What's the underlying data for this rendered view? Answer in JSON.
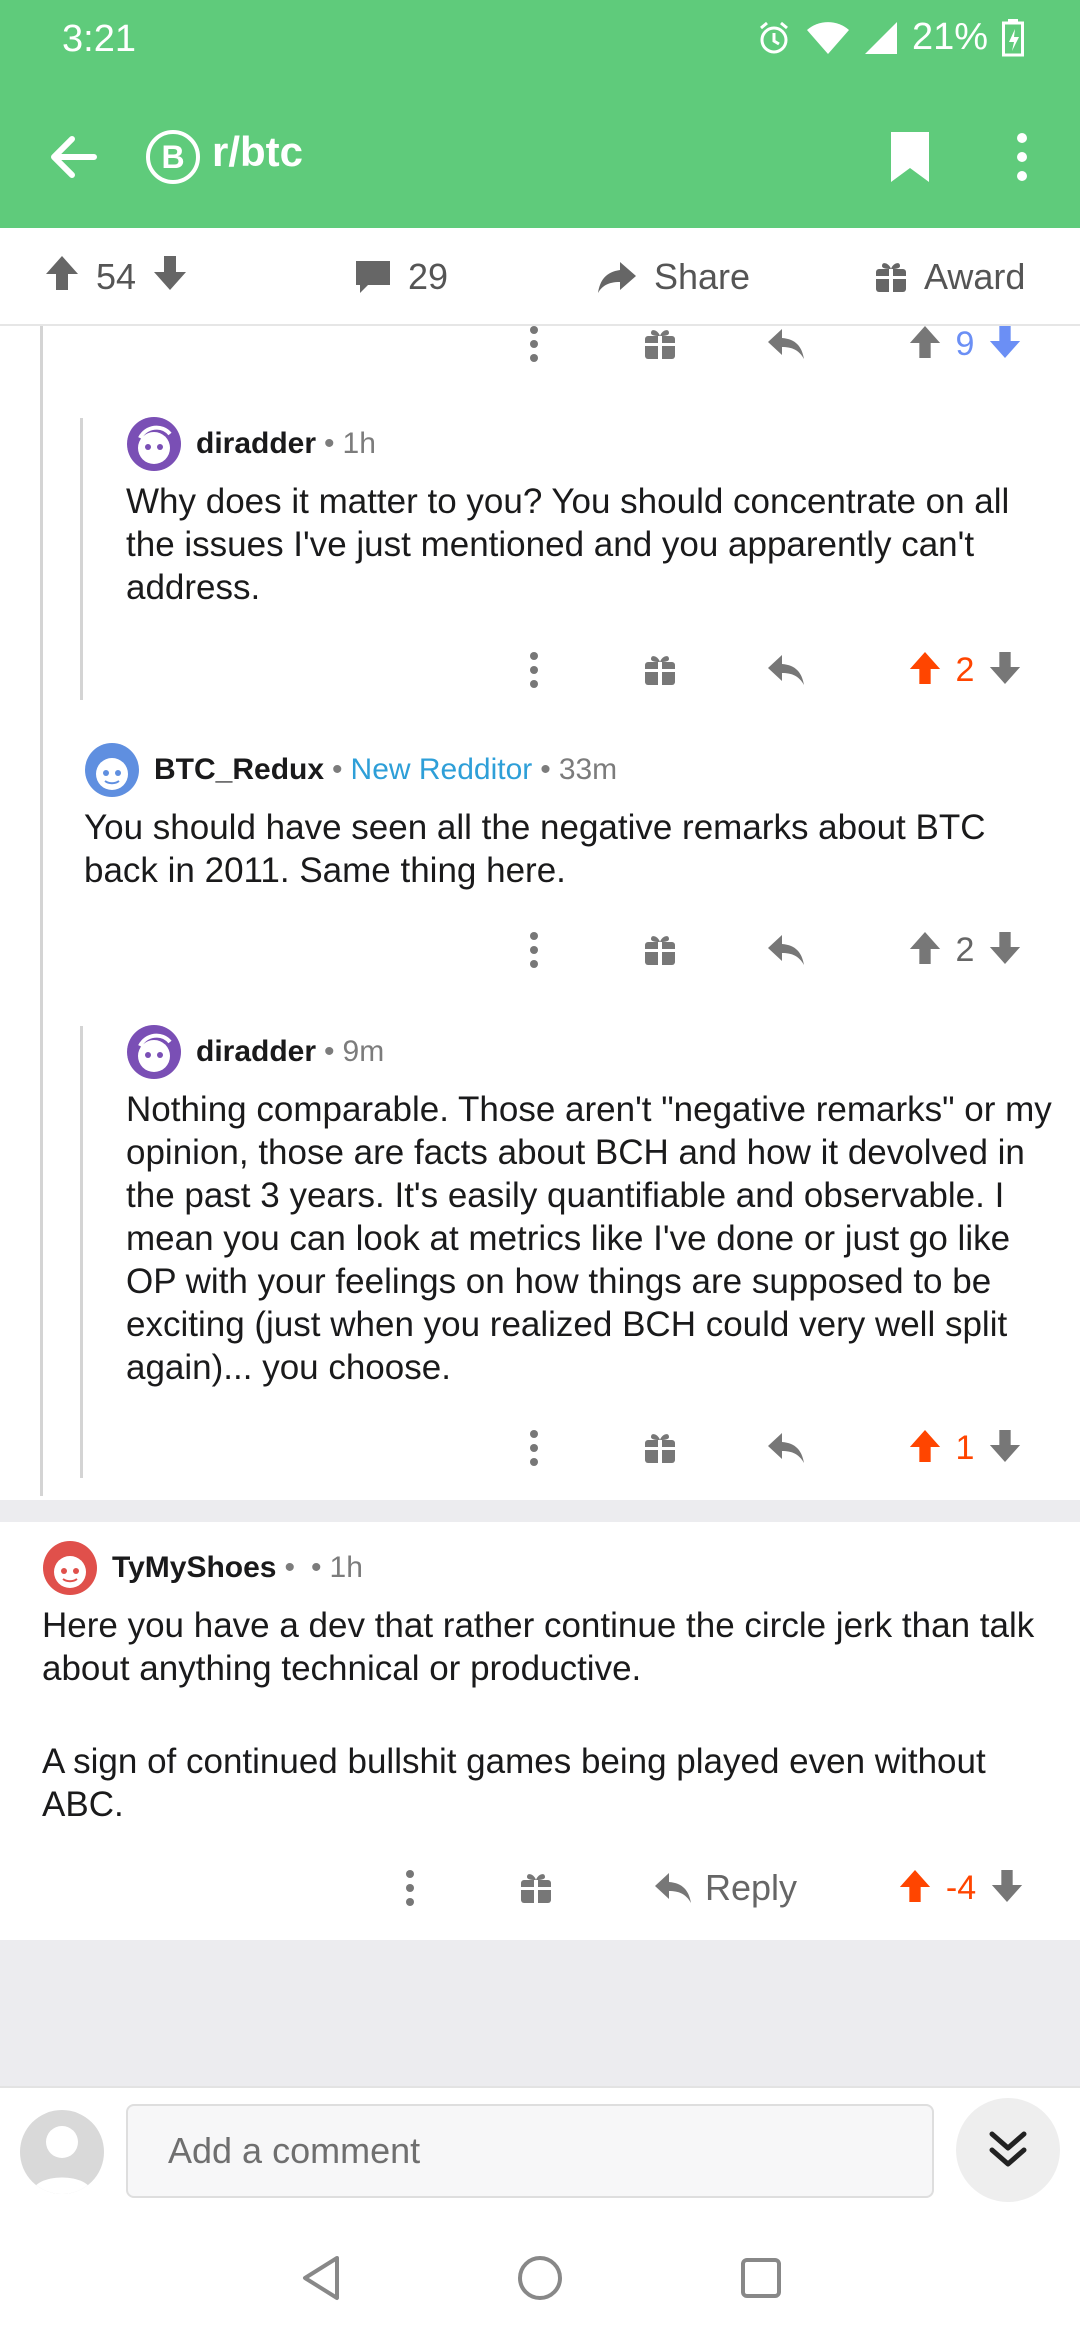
{
  "status_bar": {
    "time": "3:21",
    "battery": "21%"
  },
  "app_bar": {
    "subreddit": "r/btc",
    "subreddit_icon_letter": "B"
  },
  "post_bar": {
    "score": "54",
    "comments": "29",
    "share_label": "Share",
    "award_label": "Award"
  },
  "colors": {
    "header_green": "#5fcb7b",
    "upvote_orange": "#ff4500",
    "flair_blue": "#2e9fd8",
    "downvote_blue": "#6b8ff5"
  },
  "comments": [
    {
      "score": "9"
    },
    {
      "author": "diradder",
      "time": "1h",
      "body": "Why does it matter to you? You should concentrate on all the issues I've just mentioned and you apparently can't address.",
      "score": "2"
    },
    {
      "author": "BTC_Redux",
      "flair": "New Redditor",
      "time": "33m",
      "body": "You should have seen all the negative remarks about BTC back in 2011.  Same thing here.",
      "score": "2"
    },
    {
      "author": "diradder",
      "time": "9m",
      "body": "Nothing comparable. Those aren't \"negative remarks\" or my opinion, those are facts about BCH and how it devolved in the past 3 years. It's easily quantifiable and observable. I mean you can look at metrics like I've done or just go like OP with your feelings on how things are supposed to be exciting (just when you realized BCH could very well split again)... you choose.",
      "score": "1"
    },
    {
      "author": "TyMyShoes",
      "time": "1h",
      "body_p1": "Here you have a dev that rather continue the circle jerk than talk about anything technical or productive.",
      "body_p2": "A sign of continued bullshit games being played even without ABC.",
      "reply_label": "Reply",
      "score": "-4"
    }
  ],
  "compose": {
    "placeholder": "Add a comment"
  }
}
